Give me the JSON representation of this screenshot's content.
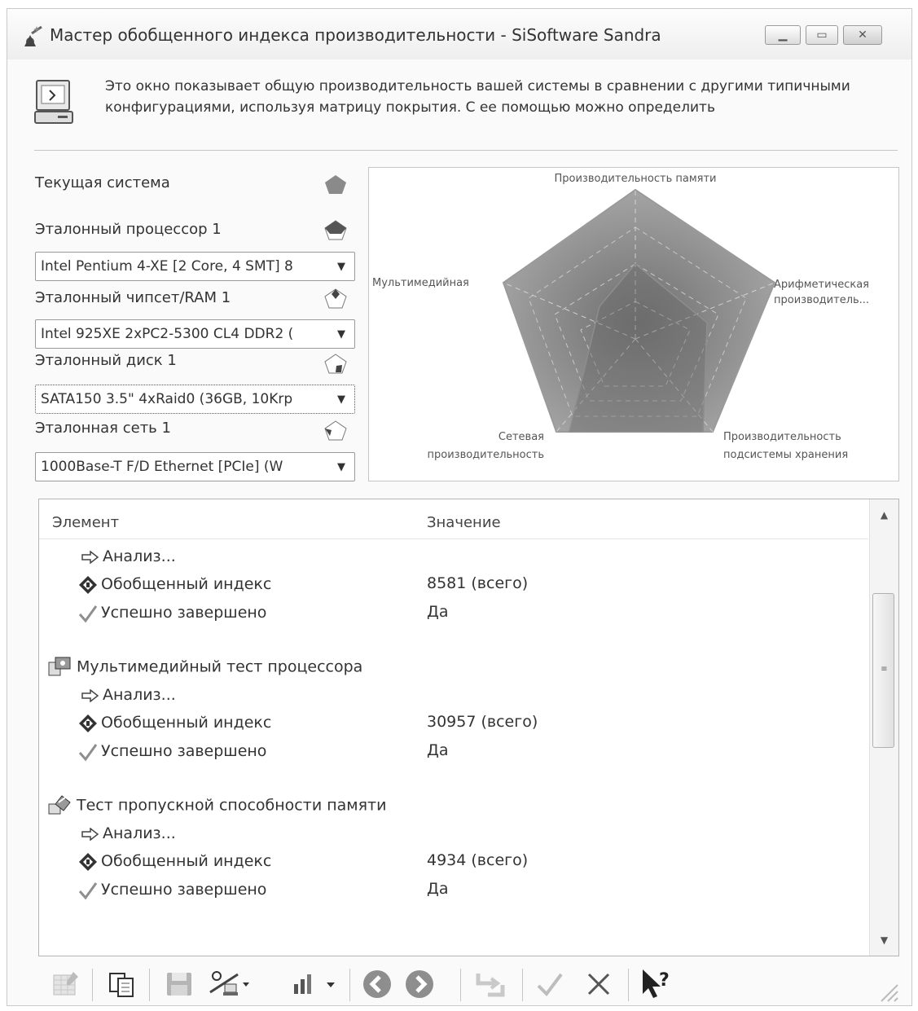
{
  "window": {
    "title": "Мастер обобщенного индекса производительности - SiSoftware Sandra",
    "controls": [
      "minimize",
      "maximize",
      "close"
    ]
  },
  "intro": {
    "text": "Это окно показывает общую производительность вашей системы в сравнении с другими типичными конфигурациями, используя матрицу покрытия. С ее помощью можно определить"
  },
  "panel": {
    "current_label": "Текущая система",
    "cpu_label": "Эталонный процессор 1",
    "cpu_value": "Intel Pentium 4-XE [2 Core, 4 SMT] 8",
    "chipset_label": "Эталонный чипсет/RAM 1",
    "chipset_value": "Intel 925XE 2xPC2-5300 CL4 DDR2 (",
    "disk_label": "Эталонный диск 1",
    "disk_value": "SATA150 3.5\" 4xRaid0 (36GB, 10Krp",
    "net_label": "Эталонная сеть 1",
    "net_value": "1000Base-T F/D Ethernet [PCIe] (W"
  },
  "radar": {
    "axis_top": "Производительность памяти",
    "axis_right_1": "Арифметическая",
    "axis_right_2": "производитель...",
    "axis_bottom_right_1": "Производительность",
    "axis_bottom_right_2": "подсистемы хранения",
    "axis_bottom_left_1": "Сетевая",
    "axis_bottom_left_2": "производительность",
    "axis_left": "Мультимедийная"
  },
  "list": {
    "col_element": "Элемент",
    "col_value": "Значение",
    "rows": [
      {
        "text": "Анализ...",
        "value": ""
      },
      {
        "text": "Обобщенный индекс",
        "value": "8581 (всего)"
      },
      {
        "text": "Успешно завершено",
        "value": "Да"
      },
      {
        "text": "Мультимедийный тест процессора",
        "value": ""
      },
      {
        "text": "Анализ...",
        "value": ""
      },
      {
        "text": "Обобщенный индекс",
        "value": "30957 (всего)"
      },
      {
        "text": "Успешно завершено",
        "value": "Да"
      },
      {
        "text": "Тест пропускной способности памяти",
        "value": ""
      },
      {
        "text": "Анализ...",
        "value": ""
      },
      {
        "text": "Обобщенный индекс",
        "value": "4934 (всего)"
      },
      {
        "text": "Успешно завершено",
        "value": "Да"
      }
    ]
  },
  "toolbar": {
    "buttons": [
      "report-icon",
      "copy-icon",
      "save-icon",
      "send-icon",
      "chart-options-icon",
      "back-icon",
      "forward-icon",
      "refresh-icon",
      "ok-icon",
      "cancel-icon",
      "help-icon"
    ]
  }
}
